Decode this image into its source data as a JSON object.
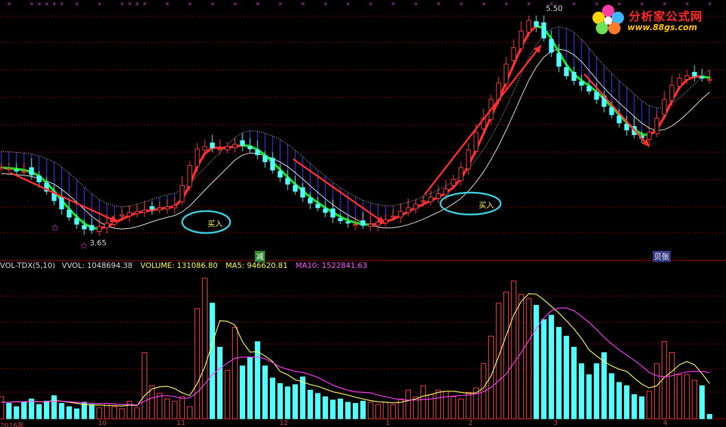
{
  "logo": {
    "title": "分析家公式网",
    "url": "www.88gs.com"
  },
  "price_panel": {
    "high_label": "5.50",
    "low_label": "3.65",
    "buy_signal_label": "买入",
    "marker_jian": "减",
    "marker_zhang": "贝张"
  },
  "vol_panel": {
    "indicator": "VOL-TDX(5,10)",
    "vvol": "VVOL: 1048694.38",
    "volume": "VOLUME: 131086.80",
    "ma5": "MA5: 946620.81",
    "ma10": "MA10: 1522841.63"
  },
  "x_axis": {
    "labels": [
      "2016年",
      "10",
      "11",
      "12",
      "1",
      "2",
      "3",
      "4"
    ]
  },
  "colors": {
    "background": "#000000",
    "up": "#ff4040",
    "down": "#54ffff",
    "grid": "#8b0000",
    "ma5": "#ffff66",
    "ma10": "#ff40ff",
    "trend_arrow": "#ff3030",
    "circle": "#3fd0e0"
  },
  "chart_data": [
    {
      "type": "candlestick",
      "y_range": [
        3.5,
        5.6
      ],
      "markers": [
        {
          "label": "5.50",
          "value": 5.5
        },
        {
          "label": "3.65",
          "value": 3.65
        }
      ],
      "annotations": [
        "买入",
        "买入",
        "减",
        "贝张"
      ],
      "series": [
        {
          "name": "",
          "close": [
            4.2,
            4.19,
            4.18,
            4.17,
            4.14,
            4.08,
            4.0,
            3.92,
            3.85,
            3.78,
            3.72,
            3.68,
            3.67,
            3.7,
            3.73,
            3.76,
            3.8,
            3.82,
            3.83,
            3.84,
            3.85,
            3.86,
            3.87,
            3.88,
            4.05,
            4.22,
            4.36,
            4.38,
            4.37,
            4.36,
            4.38,
            4.4,
            4.39,
            4.36,
            4.31,
            4.25,
            4.18,
            4.12,
            4.06,
            4.0,
            3.95,
            3.9,
            3.86,
            3.82,
            3.78,
            3.75,
            3.73,
            3.72,
            3.71,
            3.72,
            3.74,
            3.76,
            3.79,
            3.83,
            3.86,
            3.89,
            3.92,
            3.95,
            3.98,
            4.02,
            4.1,
            4.2,
            4.35,
            4.5,
            4.62,
            4.78,
            4.92,
            5.08,
            5.22,
            5.36,
            5.45,
            5.4,
            5.3,
            5.18,
            5.06,
            4.98,
            4.94,
            4.9,
            4.85,
            4.78,
            4.72,
            4.65,
            4.58,
            4.52,
            4.48,
            4.45,
            4.5,
            4.62,
            4.78,
            4.9,
            4.96,
            4.98,
            4.98,
            4.96,
            4.95
          ]
        }
      ]
    },
    {
      "type": "bar",
      "title": "VOL-TDX(5,10)",
      "series": [
        {
          "name": "VOLUME",
          "values": [
            40,
            28,
            22,
            30,
            36,
            26,
            32,
            42,
            28,
            22,
            18,
            30,
            26,
            20,
            28,
            22,
            18,
            32,
            20,
            120,
            60,
            46,
            36,
            32,
            40,
            22,
            200,
            255,
            210,
            130,
            88,
            166,
            96,
            112,
            140,
            96,
            74,
            64,
            58,
            62,
            76,
            52,
            46,
            40,
            34,
            36,
            30,
            28,
            32,
            30,
            26,
            30,
            26,
            36,
            52,
            40,
            60,
            44,
            52,
            50,
            40,
            36,
            48,
            56,
            100,
            150,
            210,
            230,
            250,
            226,
            218,
            206,
            180,
            188,
            166,
            150,
            130,
            100,
            80,
            100,
            120,
            82,
            66,
            60,
            44,
            40,
            50,
            100,
            140,
            120,
            80,
            80,
            70,
            60,
            8
          ]
        },
        {
          "name": "MA5",
          "values": [
            30,
            30,
            31,
            31,
            32,
            31,
            31,
            33,
            32,
            30,
            28,
            26,
            25,
            25,
            24,
            24,
            23,
            25,
            24,
            42,
            54,
            58,
            59,
            55,
            47,
            42,
            64,
            94,
            137,
            178,
            177,
            170,
            140,
            121,
            122,
            114,
            104,
            86,
            80,
            71,
            67,
            62,
            59,
            54,
            49,
            46,
            43,
            39,
            36,
            33,
            31,
            30,
            29,
            30,
            33,
            36,
            41,
            44,
            48,
            50,
            50,
            48,
            46,
            47,
            56,
            78,
            113,
            151,
            188,
            213,
            227,
            226,
            216,
            204,
            192,
            178,
            163,
            146,
            125,
            114,
            104,
            96,
            90,
            86,
            74,
            63,
            56,
            60,
            75,
            86,
            98,
            104,
            98,
            82,
            64
          ]
        },
        {
          "name": "MA10",
          "values": [
            30,
            30,
            31,
            31,
            32,
            31,
            31,
            32,
            32,
            31,
            30,
            29,
            28,
            28,
            28,
            27,
            26,
            26,
            25,
            32,
            38,
            41,
            42,
            40,
            37,
            38,
            48,
            63,
            80,
            91,
            101,
            110,
            112,
            112,
            112,
            109,
            102,
            94,
            90,
            86,
            84,
            80,
            75,
            68,
            61,
            56,
            52,
            49,
            48,
            47,
            43,
            40,
            37,
            35,
            34,
            34,
            35,
            36,
            38,
            40,
            41,
            42,
            43,
            45,
            49,
            57,
            69,
            81,
            101,
            120,
            142,
            164,
            183,
            196,
            201,
            201,
            196,
            186,
            175,
            162,
            148,
            136,
            125,
            116,
            106,
            96,
            84,
            78,
            76,
            78,
            82,
            85,
            86,
            86,
            84
          ]
        }
      ]
    }
  ]
}
